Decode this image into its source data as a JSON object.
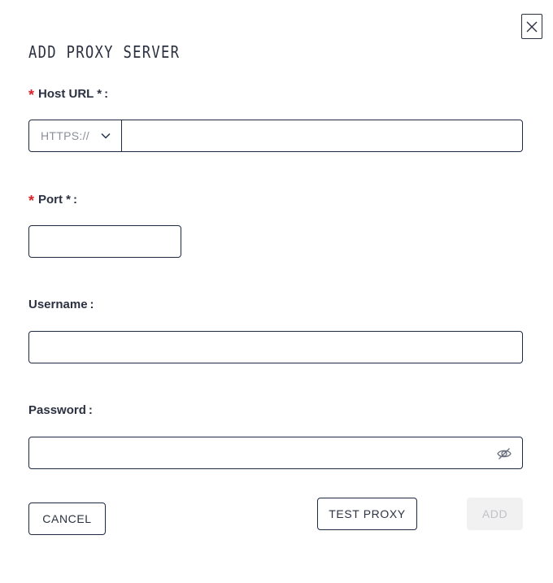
{
  "dialog": {
    "title": "ADD PROXY SERVER",
    "close_icon": "close-icon"
  },
  "host": {
    "label": "Host URL *",
    "required_marker": "*",
    "colon": ":",
    "scheme_value": "HTTPS://",
    "scheme_icon": "chevron-down-icon",
    "value": ""
  },
  "port": {
    "label": "Port *",
    "required_marker": "*",
    "colon": ":",
    "value": ""
  },
  "username": {
    "label": "Username",
    "colon": ":",
    "value": ""
  },
  "password": {
    "label": "Password",
    "colon": ":",
    "value": "",
    "visibility_icon": "eye-off-icon"
  },
  "actions": {
    "cancel_label": "CANCEL",
    "test_label": "TEST PROXY",
    "add_label": "ADD",
    "add_disabled": true
  },
  "colors": {
    "required": "#d8222a",
    "border": "#1e2a44",
    "text": "#2b3140",
    "disabled_bg": "#f1f1f2",
    "disabled_text": "#c0c2c6"
  }
}
